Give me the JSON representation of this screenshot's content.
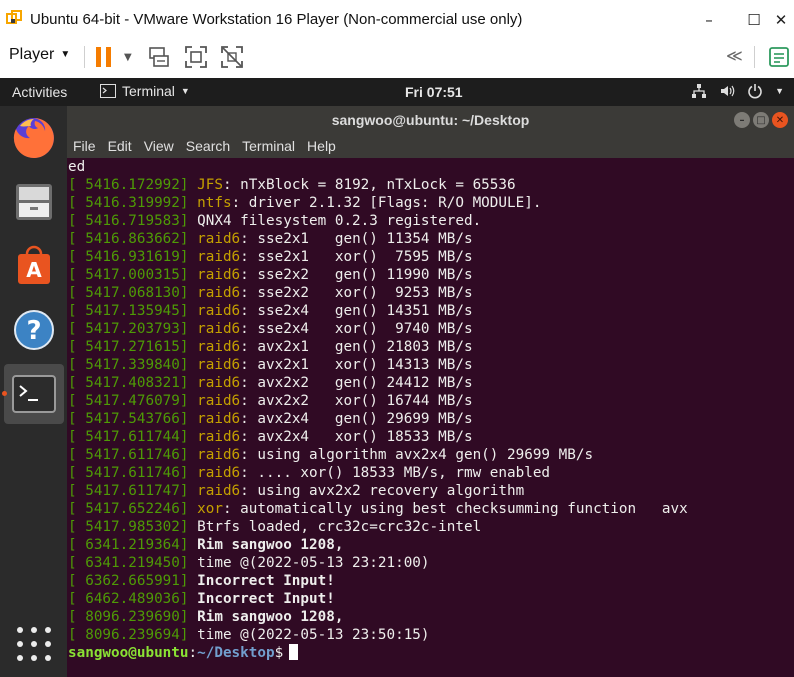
{
  "vmware": {
    "title": "Ubuntu 64-bit - VMware Workstation 16 Player (Non-commercial use only)",
    "player_menu": "Player",
    "window_buttons": {
      "minimize": "–",
      "maximize": "☐",
      "close": "✕"
    }
  },
  "ubuntu_bar": {
    "activities": "Activities",
    "app_name": "Terminal",
    "clock": "Fri 07:51"
  },
  "dock": {
    "items": [
      "firefox",
      "files",
      "software-center",
      "help",
      "terminal",
      "show-applications"
    ]
  },
  "terminal": {
    "title": "sangwoo@ubuntu: ~/Desktop",
    "menu": [
      "File",
      "Edit",
      "View",
      "Search",
      "Terminal",
      "Help"
    ],
    "first_line": "ed",
    "lines": [
      {
        "ts": "[ 5416.172992]",
        "key": "JFS",
        "msg": ": nTxBlock = 8192, nTxLock = 65536"
      },
      {
        "ts": "[ 5416.319992]",
        "key": "ntfs",
        "msg": ": driver 2.1.32 [Flags: R/O MODULE]."
      },
      {
        "ts": "[ 5416.719583]",
        "key": "",
        "msg": "QNX4 filesystem 0.2.3 registered."
      },
      {
        "ts": "[ 5416.863662]",
        "key": "raid6",
        "msg": ": sse2x1   gen() 11354 MB/s"
      },
      {
        "ts": "[ 5416.931619]",
        "key": "raid6",
        "msg": ": sse2x1   xor()  7595 MB/s"
      },
      {
        "ts": "[ 5417.000315]",
        "key": "raid6",
        "msg": ": sse2x2   gen() 11990 MB/s"
      },
      {
        "ts": "[ 5417.068130]",
        "key": "raid6",
        "msg": ": sse2x2   xor()  9253 MB/s"
      },
      {
        "ts": "[ 5417.135945]",
        "key": "raid6",
        "msg": ": sse2x4   gen() 14351 MB/s"
      },
      {
        "ts": "[ 5417.203793]",
        "key": "raid6",
        "msg": ": sse2x4   xor()  9740 MB/s"
      },
      {
        "ts": "[ 5417.271615]",
        "key": "raid6",
        "msg": ": avx2x1   gen() 21803 MB/s"
      },
      {
        "ts": "[ 5417.339840]",
        "key": "raid6",
        "msg": ": avx2x1   xor() 14313 MB/s"
      },
      {
        "ts": "[ 5417.408321]",
        "key": "raid6",
        "msg": ": avx2x2   gen() 24412 MB/s"
      },
      {
        "ts": "[ 5417.476079]",
        "key": "raid6",
        "msg": ": avx2x2   xor() 16744 MB/s"
      },
      {
        "ts": "[ 5417.543766]",
        "key": "raid6",
        "msg": ": avx2x4   gen() 29699 MB/s"
      },
      {
        "ts": "[ 5417.611744]",
        "key": "raid6",
        "msg": ": avx2x4   xor() 18533 MB/s"
      },
      {
        "ts": "[ 5417.611746]",
        "key": "raid6",
        "msg": ": using algorithm avx2x4 gen() 29699 MB/s"
      },
      {
        "ts": "[ 5417.611746]",
        "key": "raid6",
        "msg": ": .... xor() 18533 MB/s, rmw enabled"
      },
      {
        "ts": "[ 5417.611747]",
        "key": "raid6",
        "msg": ": using avx2x2 recovery algorithm"
      },
      {
        "ts": "[ 5417.652246]",
        "key": "xor",
        "msg": ": automatically using best checksumming function   avx"
      },
      {
        "ts": "[ 5417.985302]",
        "key": "",
        "msg": "Btrfs loaded, crc32c=crc32c-intel"
      },
      {
        "ts": "[ 6341.219364]",
        "key": "",
        "msg": "Rim sangwoo 1208,",
        "bold": true
      },
      {
        "ts": "[ 6341.219450]",
        "key": "",
        "msg": "time @(2022-05-13 23:21:00)"
      },
      {
        "ts": "[ 6362.665991]",
        "key": "",
        "msg": "Incorrect Input!",
        "bold": true
      },
      {
        "ts": "[ 6462.489036]",
        "key": "",
        "msg": "Incorrect Input!",
        "bold": true
      },
      {
        "ts": "[ 8096.239690]",
        "key": "",
        "msg": "Rim sangwoo 1208,",
        "bold": true
      },
      {
        "ts": "[ 8096.239694]",
        "key": "",
        "msg": "time @(2022-05-13 23:50:15)"
      }
    ],
    "prompt_user": "sangwoo@ubuntu",
    "prompt_sep": ":",
    "prompt_path": "~/Desktop",
    "prompt_end": "$"
  },
  "colors": {
    "terminal_bg": "#300a24",
    "timestamp": "#4e9a06",
    "keyword": "#c4a000",
    "prompt_user": "#8ae234",
    "prompt_path": "#729fcf",
    "pause_icon": "#f57c00"
  }
}
